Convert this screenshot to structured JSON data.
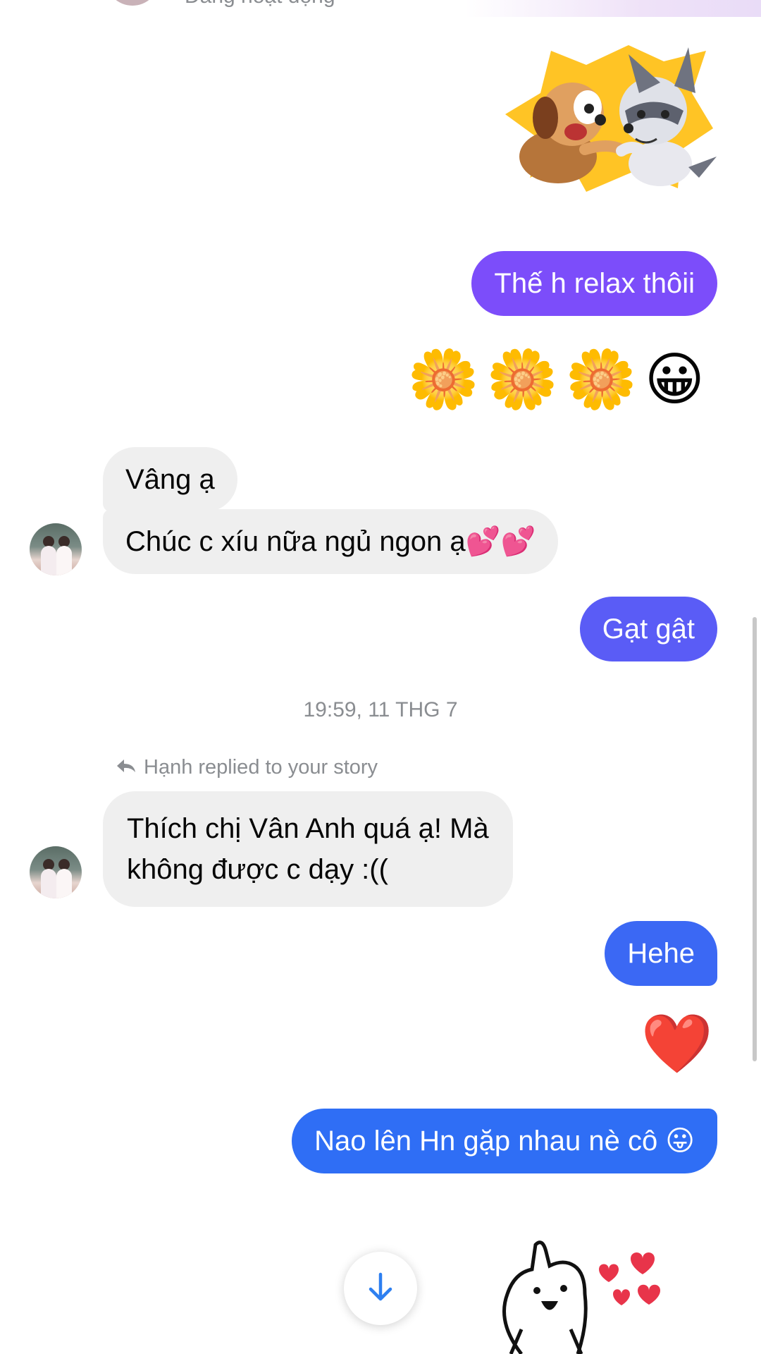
{
  "header": {
    "status": "Đang hoạt động"
  },
  "messages": {
    "m1": "Thế h relax thôii",
    "m2_emojis": "🌼🌼🌼😀",
    "m3": "Vâng ạ",
    "m4": "Chúc c xíu nữa ngủ ngon ạ💕💕",
    "m5": "Gạt gật",
    "timestamp": "19:59, 11 THG 7",
    "reply_note": "Hạnh replied to your story",
    "m6_line1": "Thích chị Vân Anh quá ạ! Mà",
    "m6_line2": "không được c dạy :((",
    "m7": "Hehe",
    "m8_emoji": "❤️",
    "m9": "Nao lên Hn gặp nhau nè cô 😛"
  },
  "colors": {
    "outgoing_purple": "#7c4dfa",
    "outgoing_indigo": "#5a5cf6",
    "outgoing_blue": "#2f6ef5",
    "incoming": "#efefef",
    "meta_text": "#8a8d91"
  },
  "icons": {
    "reply": "reply-arrow-icon",
    "scroll_down": "arrow-down-icon"
  }
}
